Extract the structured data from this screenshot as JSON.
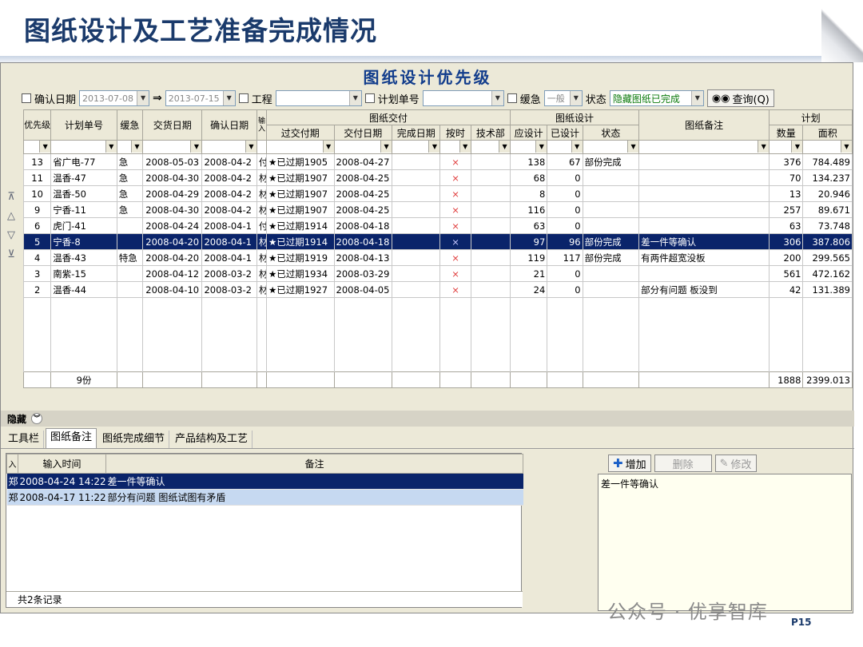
{
  "slide": {
    "title": "图纸设计及工艺准备完成情况",
    "watermark": "公众号 · 优享智库",
    "page": "P15"
  },
  "grid": {
    "caption": "图纸设计优先级"
  },
  "filter": {
    "confirm_date_label": "确认日期",
    "date_from": "2013-07-08",
    "arrow": "⇒",
    "date_to": "2013-07-15",
    "project_label": "工程",
    "plan_no_label": "计划单号",
    "urgency_label": "缓急",
    "urgency_value": "一般",
    "status_label": "状态",
    "status_value": "隐藏图纸已完成",
    "query_label": "查询(Q)"
  },
  "columns": {
    "priority": "优先级",
    "plan_no": "计划单号",
    "urgency": "缓急",
    "delivery_date": "交货日期",
    "confirm_date": "确认日期",
    "input_person": "输入",
    "drawing_delivery": "图纸交付",
    "overdue": "过交付期",
    "deliver_date": "交付日期",
    "finish_date": "完成日期",
    "on_time": "按时",
    "tech_dept": "技术部",
    "drawing_design": "图纸设计",
    "should_design": "应设计",
    "designed": "已设计",
    "status": "状态",
    "drawing_note": "图纸备注",
    "plan": "计划",
    "quantity": "数量",
    "area": "面积"
  },
  "rows": [
    {
      "pri": "13",
      "plan": "省广电-77",
      "urg": "急",
      "deliv": "2008-05-03",
      "conf": "2008-04-2",
      "inp": "付",
      "over": "★已过期1905",
      "ddate": "2008-04-27",
      "fin": "",
      "ontime": "×",
      "tech": "",
      "should": "138",
      "done": "67",
      "status": "部份完成",
      "note": "",
      "qty": "376",
      "area": "784.489"
    },
    {
      "pri": "11",
      "plan": "温香-47",
      "urg": "急",
      "deliv": "2008-04-30",
      "conf": "2008-04-2",
      "inp": "材",
      "over": "★已过期1907",
      "ddate": "2008-04-25",
      "fin": "",
      "ontime": "×",
      "tech": "",
      "should": "68",
      "done": "0",
      "status": "",
      "note": "",
      "qty": "70",
      "area": "134.237"
    },
    {
      "pri": "10",
      "plan": "温香-50",
      "urg": "急",
      "deliv": "2008-04-29",
      "conf": "2008-04-2",
      "inp": "材",
      "over": "★已过期1907",
      "ddate": "2008-04-25",
      "fin": "",
      "ontime": "×",
      "tech": "",
      "should": "8",
      "done": "0",
      "status": "",
      "note": "",
      "qty": "13",
      "area": "20.946"
    },
    {
      "pri": "9",
      "plan": "宁香-11",
      "urg": "急",
      "deliv": "2008-04-30",
      "conf": "2008-04-2",
      "inp": "材",
      "over": "★已过期1907",
      "ddate": "2008-04-25",
      "fin": "",
      "ontime": "×",
      "tech": "",
      "should": "116",
      "done": "0",
      "status": "",
      "note": "",
      "qty": "257",
      "area": "89.671"
    },
    {
      "pri": "6",
      "plan": "虎门-41",
      "urg": "",
      "deliv": "2008-04-24",
      "conf": "2008-04-1",
      "inp": "付",
      "over": "★已过期1914",
      "ddate": "2008-04-18",
      "fin": "",
      "ontime": "×",
      "tech": "",
      "should": "63",
      "done": "0",
      "status": "",
      "note": "",
      "qty": "63",
      "area": "73.748"
    },
    {
      "pri": "5",
      "plan": "宁香-8",
      "urg": "",
      "deliv": "2008-04-20",
      "conf": "2008-04-1",
      "inp": "材",
      "over": "★已过期1914",
      "ddate": "2008-04-18",
      "fin": "",
      "ontime": "×",
      "tech": "",
      "should": "97",
      "done": "96",
      "status": "部份完成",
      "note": "差一件等确认",
      "qty": "306",
      "area": "387.806",
      "selected": true
    },
    {
      "pri": "4",
      "plan": "温香-43",
      "urg": "特急",
      "deliv": "2008-04-20",
      "conf": "2008-04-1",
      "inp": "材",
      "over": "★已过期1919",
      "ddate": "2008-04-13",
      "fin": "",
      "ontime": "×",
      "tech": "",
      "should": "119",
      "done": "117",
      "status": "部份完成",
      "note": "有两件超宽没板",
      "qty": "200",
      "area": "299.565"
    },
    {
      "pri": "3",
      "plan": "南紫-15",
      "urg": "",
      "deliv": "2008-04-12",
      "conf": "2008-03-2",
      "inp": "材",
      "over": "★已过期1934",
      "ddate": "2008-03-29",
      "fin": "",
      "ontime": "×",
      "tech": "",
      "should": "21",
      "done": "0",
      "status": "",
      "note": "",
      "qty": "561",
      "area": "472.162"
    },
    {
      "pri": "2",
      "plan": "温香-44",
      "urg": "",
      "deliv": "2008-04-10",
      "conf": "2008-03-2",
      "inp": "材",
      "over": "★已过期1927",
      "ddate": "2008-04-05",
      "fin": "",
      "ontime": "×",
      "tech": "",
      "should": "24",
      "done": "0",
      "status": "",
      "note": "部分有问题 板没到",
      "qty": "42",
      "area": "131.389"
    }
  ],
  "totals": {
    "count": "9份",
    "qty": "1888",
    "area": "2399.013"
  },
  "bottom": {
    "hide_label": "隐藏",
    "tabs": [
      "工具栏",
      "图纸备注",
      "图纸完成细节",
      "产品结构及工艺"
    ],
    "note_columns": {
      "input": "入",
      "time": "输入时间",
      "note": "备注"
    },
    "notes": [
      {
        "who": "郑",
        "time": "2008-04-24 14:22",
        "note": "差一件等确认"
      },
      {
        "who": "郑",
        "time": "2008-04-17 11:22",
        "note": "部分有问题 图纸试图有矛盾"
      }
    ],
    "record_count": "共2条记录",
    "add_label": "增加",
    "delete_label": "删除",
    "edit_label": "修改",
    "note_text": "差一件等确认"
  }
}
